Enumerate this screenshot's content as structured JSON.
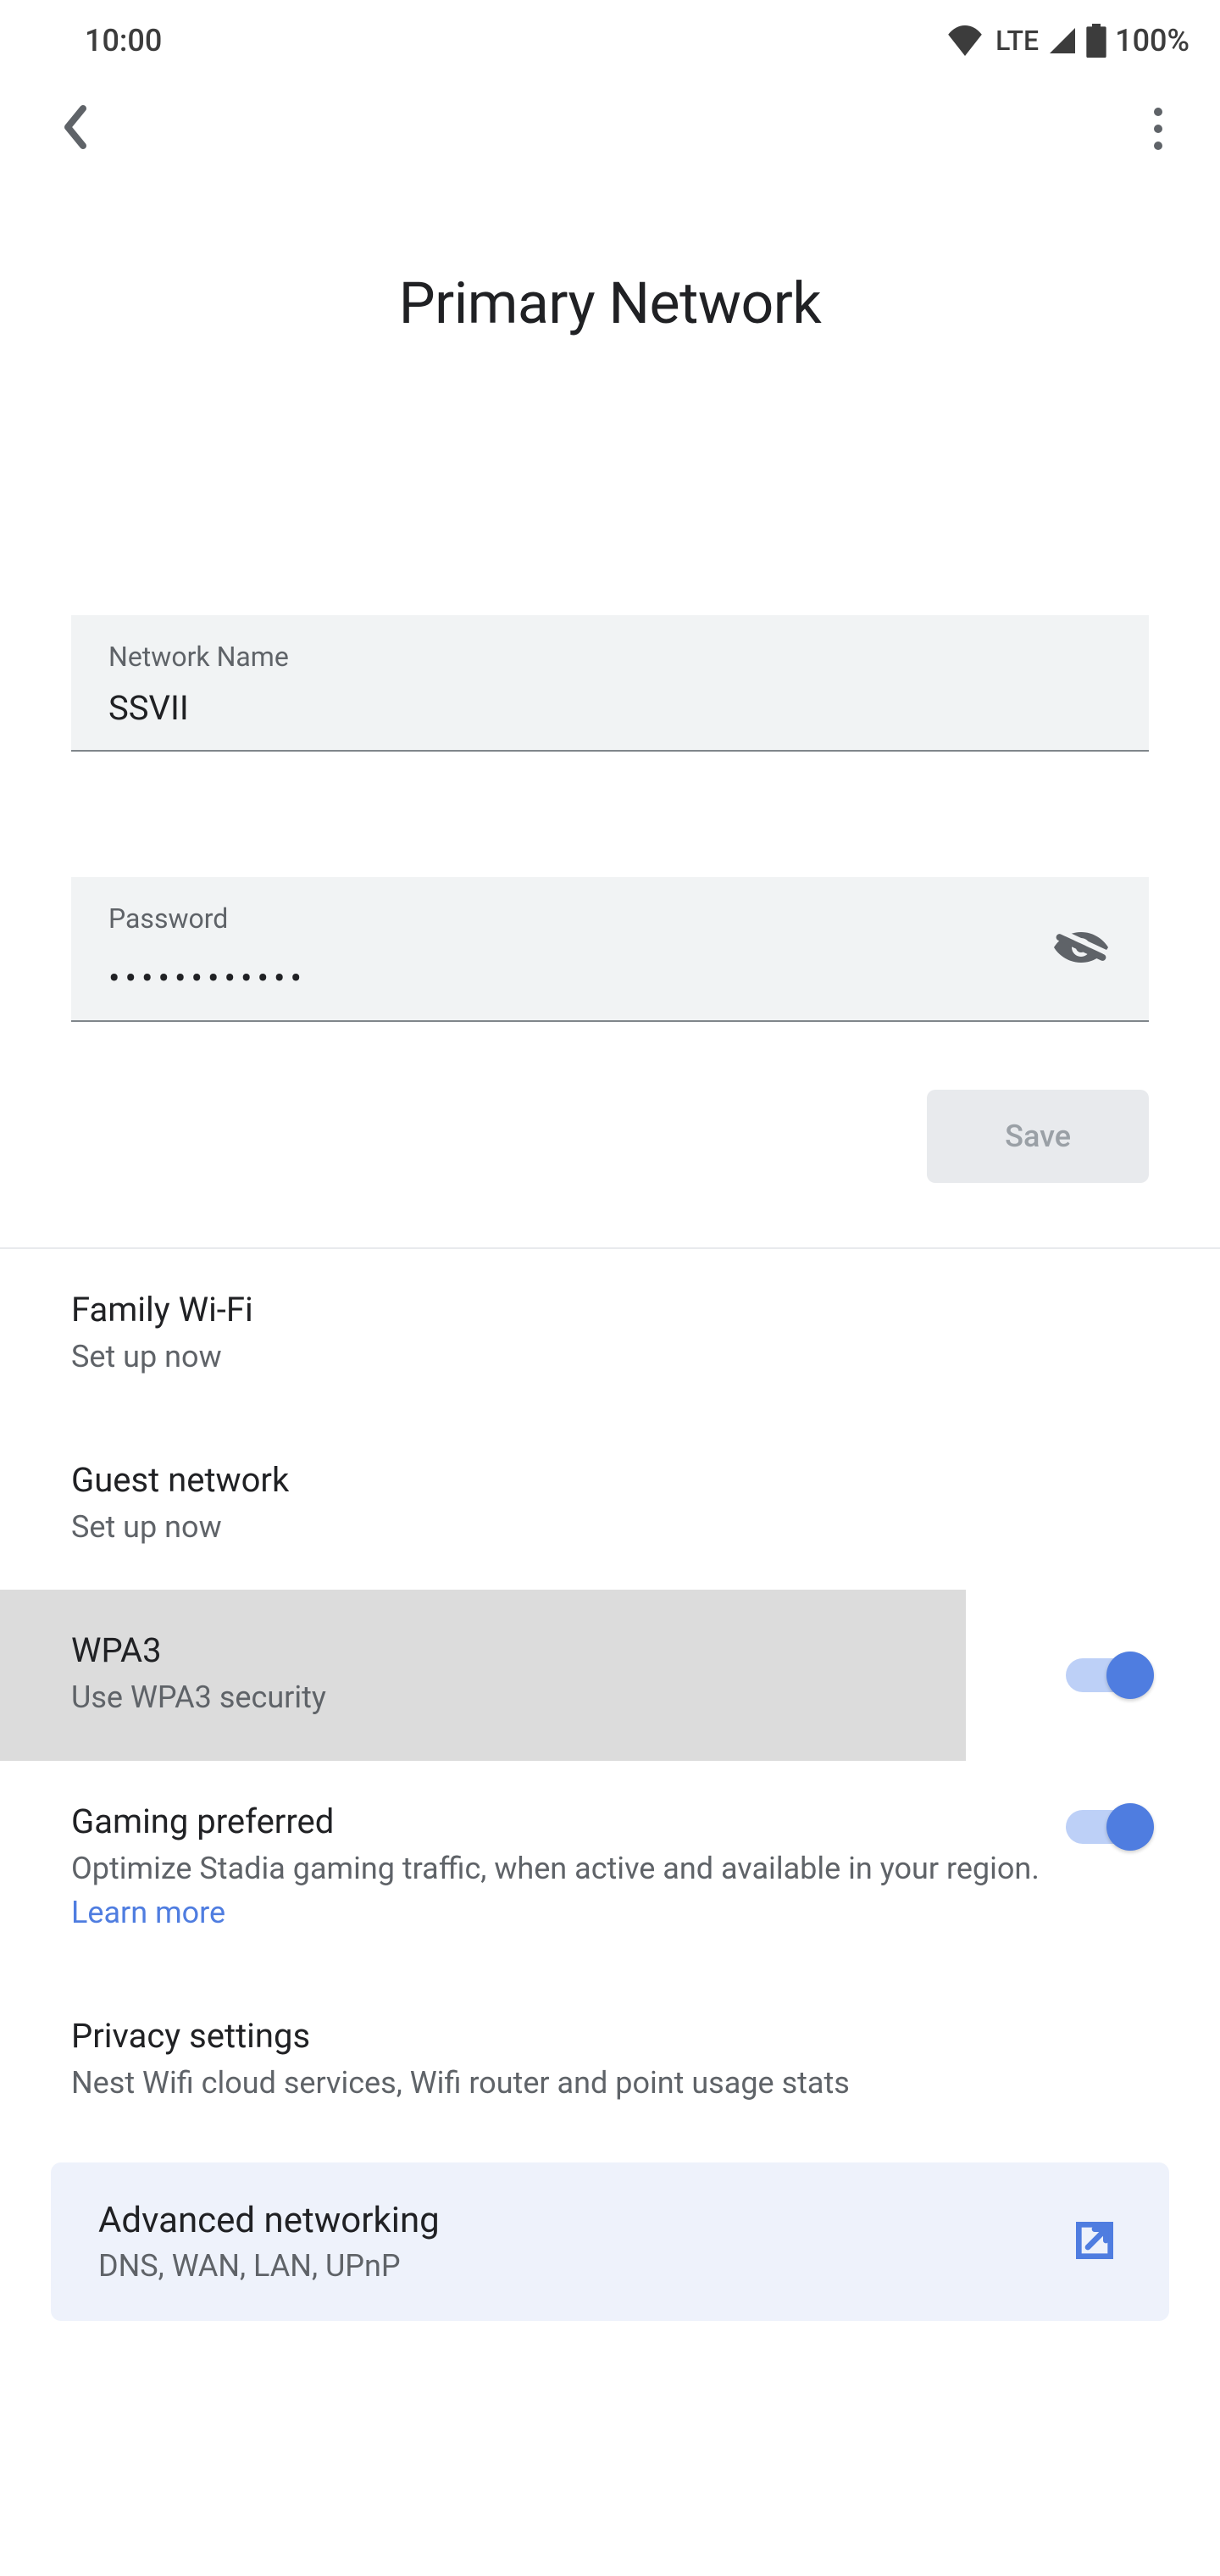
{
  "status": {
    "time": "10:00",
    "lte": "LTE",
    "battery": "100%"
  },
  "page": {
    "title": "Primary Network"
  },
  "fields": {
    "name_label": "Network Name",
    "name_value": "SSVII",
    "pw_label": "Password",
    "pw_masked": "••••••••••••",
    "save_label": "Save"
  },
  "items": {
    "family_title": "Family Wi-Fi",
    "family_sub": "Set up now",
    "guest_title": "Guest network",
    "guest_sub": "Set up now",
    "wpa3_title": "WPA3",
    "wpa3_sub": "Use WPA3 security",
    "gaming_title": "Gaming preferred",
    "gaming_sub_a": "Optimize Stadia gaming traffic, when active and available in your region. ",
    "gaming_learn": "Learn more",
    "privacy_title": "Privacy settings",
    "privacy_sub": "Nest Wifi cloud services, Wifi router and point usage stats"
  },
  "advanced": {
    "title": "Advanced networking",
    "sub": "DNS, WAN, LAN, UPnP"
  }
}
